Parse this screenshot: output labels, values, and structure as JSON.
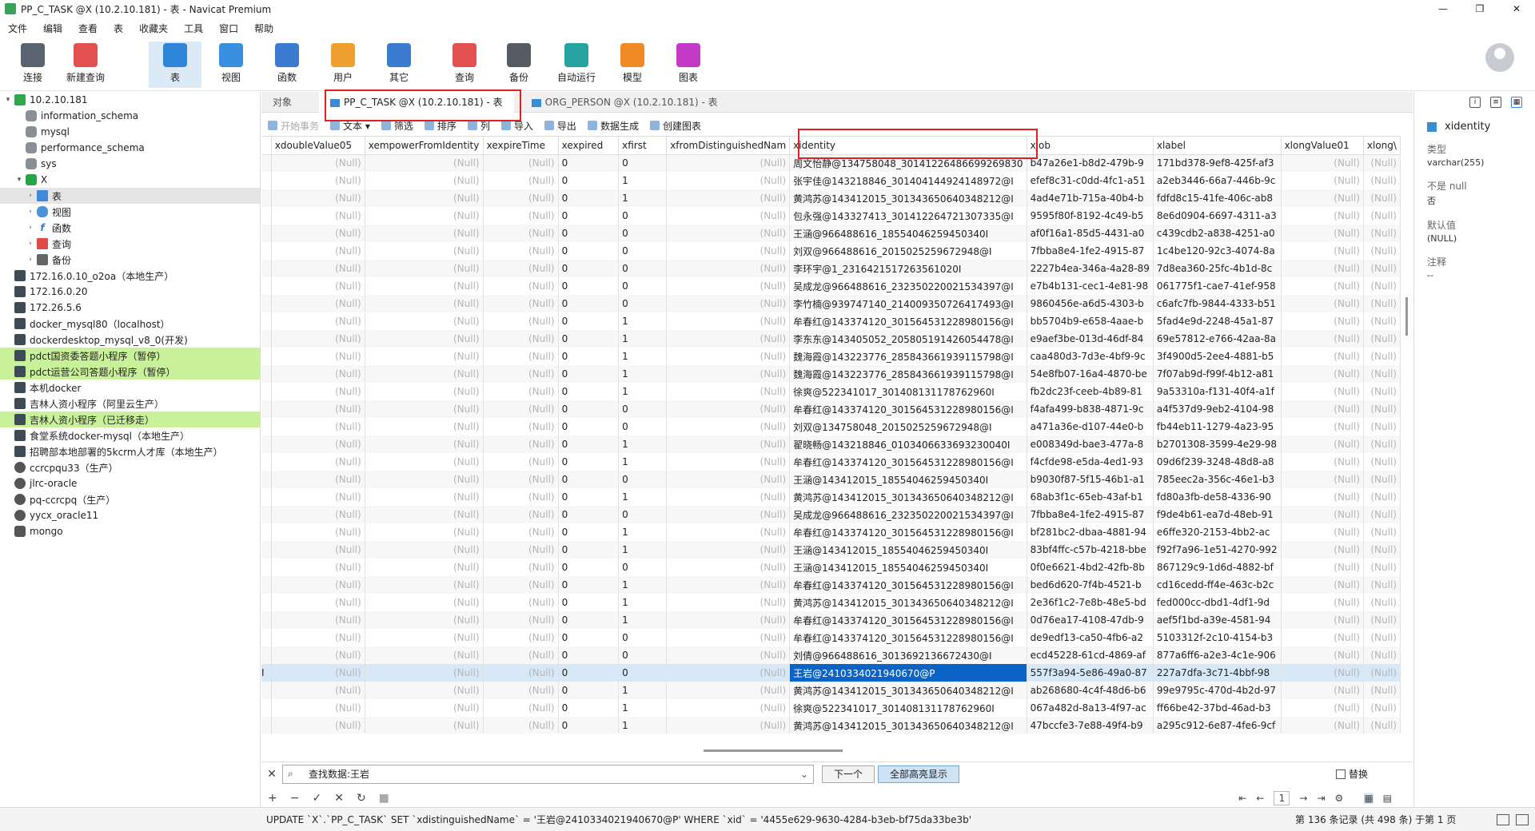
{
  "window": {
    "title": "PP_C_TASK @X (10.2.10.181) - 表 - Navicat Premium",
    "controls": [
      "—",
      "❐",
      "✕"
    ]
  },
  "menu": [
    "文件",
    "编辑",
    "查看",
    "表",
    "收藏夹",
    "工具",
    "窗口",
    "帮助"
  ],
  "toolbar": [
    {
      "label": "连接",
      "icon": "connect-icon",
      "color": "#5a6470"
    },
    {
      "label": "新建查询",
      "icon": "new-query-icon",
      "color": "#e35050"
    },
    {
      "label": "表",
      "icon": "table-icon",
      "color": "#2f86d9"
    },
    {
      "label": "视图",
      "icon": "view-icon",
      "color": "#3a8fe0"
    },
    {
      "label": "函数",
      "icon": "function-icon",
      "color": "#3b7bd0"
    },
    {
      "label": "用户",
      "icon": "user-icon",
      "color": "#f0a030"
    },
    {
      "label": "其它",
      "icon": "tools-icon",
      "color": "#3b7bd0"
    },
    {
      "label": "查询",
      "icon": "query-icon",
      "color": "#e35050"
    },
    {
      "label": "备份",
      "icon": "backup-icon",
      "color": "#555b63"
    },
    {
      "label": "自动运行",
      "icon": "robot-icon",
      "color": "#27a3a0"
    },
    {
      "label": "模型",
      "icon": "model-icon",
      "color": "#f08a24"
    },
    {
      "label": "图表",
      "icon": "chart-icon",
      "color": "#c23ac6"
    }
  ],
  "sidebar": {
    "items": [
      {
        "label": "10.2.10.181",
        "level": 0,
        "icon": "conn-green",
        "caret": "▾"
      },
      {
        "label": "information_schema",
        "level": 1,
        "icon": "db"
      },
      {
        "label": "mysql",
        "level": 1,
        "icon": "db"
      },
      {
        "label": "performance_schema",
        "level": 1,
        "icon": "db"
      },
      {
        "label": "sys",
        "level": 1,
        "icon": "db"
      },
      {
        "label": "X",
        "level": 1,
        "icon": "db-green",
        "caret": "▾"
      },
      {
        "label": "表",
        "level": 2,
        "icon": "tbl",
        "caret": "›",
        "selected": true
      },
      {
        "label": "视图",
        "level": 2,
        "icon": "view",
        "caret": "›"
      },
      {
        "label": "函数",
        "level": 2,
        "icon": "fn",
        "caret": "›"
      },
      {
        "label": "查询",
        "level": 2,
        "icon": "query",
        "caret": "›"
      },
      {
        "label": "备份",
        "level": 2,
        "icon": "backup",
        "caret": "›"
      },
      {
        "label": "172.16.0.10_o2oa（本地生产）",
        "level": 0,
        "icon": "conn-dark"
      },
      {
        "label": "172.16.0.20",
        "level": 0,
        "icon": "conn-dark"
      },
      {
        "label": "172.26.5.6",
        "level": 0,
        "icon": "conn-dark"
      },
      {
        "label": "docker_mysql80（localhost）",
        "level": 0,
        "icon": "conn-dark"
      },
      {
        "label": "dockerdesktop_mysql_v8_0(开发)",
        "level": 0,
        "icon": "conn-dark"
      },
      {
        "label": "pdct国资委答题小程序（暂停）",
        "level": 0,
        "icon": "conn-dark",
        "highlight": true
      },
      {
        "label": "pdct运营公司答题小程序（暂停）",
        "level": 0,
        "icon": "conn-dark",
        "highlight": true
      },
      {
        "label": "本机docker",
        "level": 0,
        "icon": "conn-dark"
      },
      {
        "label": "吉林人资小程序（阿里云生产）",
        "level": 0,
        "icon": "conn-dark"
      },
      {
        "label": "吉林人资小程序（已迁移走）",
        "level": 0,
        "icon": "conn-dark",
        "highlight": true
      },
      {
        "label": "食堂系统docker-mysql（本地生产）",
        "level": 0,
        "icon": "conn-dark"
      },
      {
        "label": "招聘部本地部署的5kcrm人才库（本地生产）",
        "level": 0,
        "icon": "conn-dark"
      },
      {
        "label": "ccrcpqu33（生产）",
        "level": 0,
        "icon": "circle"
      },
      {
        "label": "jlrc-oracle",
        "level": 0,
        "icon": "circle"
      },
      {
        "label": "pq-ccrcpq（生产）",
        "level": 0,
        "icon": "circle"
      },
      {
        "label": "yycx_oracle11",
        "level": 0,
        "icon": "circle"
      },
      {
        "label": "mongo",
        "level": 0,
        "icon": "mongo"
      }
    ]
  },
  "tabs": [
    {
      "label": "对象",
      "active": false
    },
    {
      "label": "PP_C_TASK @X (10.2.10.181) - 表",
      "active": true
    },
    {
      "label": "ORG_PERSON @X (10.2.10.181) - 表",
      "active": false
    }
  ],
  "subtoolbar": [
    {
      "label": "开始事务",
      "disabled": true
    },
    {
      "label": "文本 ▾",
      "disabled": false
    },
    {
      "label": "筛选",
      "disabled": false
    },
    {
      "label": "排序",
      "disabled": false
    },
    {
      "label": "列",
      "disabled": false
    },
    {
      "label": "导入",
      "disabled": false
    },
    {
      "label": "导出",
      "disabled": false
    },
    {
      "label": "数据生成",
      "disabled": false
    },
    {
      "label": "创建图表",
      "disabled": false
    }
  ],
  "grid": {
    "columns": [
      "xdoubleValue05",
      "xempowerFromIdentity",
      "xexpireTime",
      "xexpired",
      "xfirst",
      "xfromDistinguishedNam",
      "xidentity",
      "xjob",
      "xlabel",
      "xlongValue01",
      "xlong\\"
    ],
    "null_text": "(Null)",
    "rows": [
      {
        "xexpired": "0",
        "xfirst": "0",
        "xidentity": "周文怡静@134758048_30141226486699269830",
        "xjob": "b47a26e1-b8d2-479b-9",
        "xlabel": "171bd378-9ef8-425f-af3"
      },
      {
        "xexpired": "0",
        "xfirst": "1",
        "xidentity": "张宇佳@143218846_301404144924148972@I",
        "xjob": "efef8c31-c0dd-4fc1-a51",
        "xlabel": "a2eb3446-66a7-446b-9c"
      },
      {
        "xexpired": "0",
        "xfirst": "1",
        "xidentity": "黄鸿苏@143412015_301343650640348212@I",
        "xjob": "4ad4e71b-715a-40b4-b",
        "xlabel": "fdfd8c15-41fe-406c-ab8"
      },
      {
        "xexpired": "0",
        "xfirst": "0",
        "xidentity": "包永强@143327413_301412264721307335@I",
        "xjob": "9595f80f-8192-4c49-b5",
        "xlabel": "8e6d0904-6697-4311-a3"
      },
      {
        "xexpired": "0",
        "xfirst": "0",
        "xidentity": "王涵@966488616_18554046259450340I",
        "xjob": "af0f16a1-85d5-4431-a0",
        "xlabel": "c439cdb2-a838-4251-a0"
      },
      {
        "xexpired": "0",
        "xfirst": "0",
        "xidentity": "刘双@966488616_2015025259672948@I",
        "xjob": "7fbba8e4-1fe2-4915-87",
        "xlabel": "1c4be120-92c3-4074-8a"
      },
      {
        "xexpired": "0",
        "xfirst": "0",
        "xidentity": "李环宇@1_2316421517263561020I",
        "xjob": "2227b4ea-346a-4a28-89",
        "xlabel": "7d8ea360-25fc-4b1d-8c"
      },
      {
        "xexpired": "0",
        "xfirst": "0",
        "xidentity": "吴成龙@966488616_232350220021534397@I",
        "xjob": "e7b4b131-cec1-4e81-98",
        "xlabel": "061775f1-cae7-41ef-958"
      },
      {
        "xexpired": "0",
        "xfirst": "0",
        "xidentity": "李竹楠@939747140_214009350726417493@I",
        "xjob": "9860456e-a6d5-4303-b",
        "xlabel": "c6afc7fb-9844-4333-b51"
      },
      {
        "xexpired": "0",
        "xfirst": "1",
        "xidentity": "牟春红@143374120_301564531228980156@I",
        "xjob": "bb5704b9-e658-4aae-b",
        "xlabel": "5fad4e9d-2248-45a1-87"
      },
      {
        "xexpired": "0",
        "xfirst": "1",
        "xidentity": "李东东@143405052_205805191426054478@I",
        "xjob": "e9aef3be-013d-46df-84",
        "xlabel": "69e57812-e766-42aa-8a"
      },
      {
        "xexpired": "0",
        "xfirst": "1",
        "xidentity": "魏海霞@143223776_285843661939115798@I",
        "xjob": "caa480d3-7d3e-4bf9-9c",
        "xlabel": "3f4900d5-2ee4-4881-b5"
      },
      {
        "xexpired": "0",
        "xfirst": "1",
        "xidentity": "魏海霞@143223776_285843661939115798@I",
        "xjob": "54e8fb07-16a4-4870-be",
        "xlabel": "7f07ab9d-f99f-4b12-a81"
      },
      {
        "xexpired": "0",
        "xfirst": "1",
        "xidentity": "徐爽@522341017_301408131178762960I",
        "xjob": "fb2dc23f-ceeb-4b89-81",
        "xlabel": "9a53310a-f131-40f4-a1f"
      },
      {
        "xexpired": "0",
        "xfirst": "0",
        "xidentity": "牟春红@143374120_301564531228980156@I",
        "xjob": "f4afa499-b838-4871-9c",
        "xlabel": "a4f537d9-9eb2-4104-98"
      },
      {
        "xexpired": "0",
        "xfirst": "0",
        "xidentity": "刘双@134758048_2015025259672948@I",
        "xjob": "a471a36e-d107-44e0-b",
        "xlabel": "fb44eb11-1279-4a23-95"
      },
      {
        "xexpired": "0",
        "xfirst": "1",
        "xidentity": "翟晓畅@143218846_0103406633693230040I",
        "xjob": "e008349d-bae3-477a-8",
        "xlabel": "b2701308-3599-4e29-98"
      },
      {
        "xexpired": "0",
        "xfirst": "1",
        "xidentity": "牟春红@143374120_301564531228980156@I",
        "xjob": "f4cfde98-e5da-4ed1-93",
        "xlabel": "09d6f239-3248-48d8-a8"
      },
      {
        "xexpired": "0",
        "xfirst": "0",
        "xidentity": "王涵@143412015_18554046259450340I",
        "xjob": "b9030f87-5f15-46b1-a1",
        "xlabel": "785eec2a-356c-46e1-b3"
      },
      {
        "xexpired": "0",
        "xfirst": "1",
        "xidentity": "黄鸿苏@143412015_301343650640348212@I",
        "xjob": "68ab3f1c-65eb-43af-b1",
        "xlabel": "fd80a3fb-de58-4336-90"
      },
      {
        "xexpired": "0",
        "xfirst": "0",
        "xidentity": "吴成龙@966488616_232350220021534397@I",
        "xjob": "7fbba8e4-1fe2-4915-87",
        "xlabel": "f9de4b61-ea7d-48eb-91"
      },
      {
        "xexpired": "0",
        "xfirst": "1",
        "xidentity": "牟春红@143374120_301564531228980156@I",
        "xjob": "bf281bc2-dbaa-4881-94",
        "xlabel": "e6ffe320-2153-4bb2-ac"
      },
      {
        "xexpired": "0",
        "xfirst": "1",
        "xidentity": "王涵@143412015_18554046259450340I",
        "xjob": "83bf4ffc-c57b-4218-bbe",
        "xlabel": "f92f7a96-1e51-4270-992"
      },
      {
        "xexpired": "0",
        "xfirst": "0",
        "xidentity": "王涵@143412015_18554046259450340I",
        "xjob": "0f0e6621-4bd2-42fb-8b",
        "xlabel": "867129c9-1d6d-4882-bf"
      },
      {
        "xexpired": "0",
        "xfirst": "1",
        "xidentity": "牟春红@143374120_301564531228980156@I",
        "xjob": "bed6d620-7f4b-4521-b",
        "xlabel": "cd16cedd-ff4e-463c-b2c"
      },
      {
        "xexpired": "0",
        "xfirst": "1",
        "xidentity": "黄鸿苏@143412015_301343650640348212@I",
        "xjob": "2e36f1c2-7e8b-48e5-bd",
        "xlabel": "fed000cc-dbd1-4df1-9d"
      },
      {
        "xexpired": "0",
        "xfirst": "1",
        "xidentity": "牟春红@143374120_301564531228980156@I",
        "xjob": "0d76ea17-4108-47db-9",
        "xlabel": "aef5f1bd-a39e-4581-94"
      },
      {
        "xexpired": "0",
        "xfirst": "0",
        "xidentity": "牟春红@143374120_301564531228980156@I",
        "xjob": "de9edf13-ca50-4fb6-a2",
        "xlabel": "5103312f-2c10-4154-b3"
      },
      {
        "xexpired": "0",
        "xfirst": "0",
        "xidentity": "刘倩@966488616_3013692136672430@I",
        "xjob": "ecd45228-61cd-4869-af",
        "xlabel": "877a6ff6-a2e3-4c1e-906"
      },
      {
        "xexpired": "0",
        "xfirst": "0",
        "xidentity": "王岩@2410334021940670@P",
        "xjob": "557f3a94-5e86-49a0-87",
        "xlabel": "227a7dfa-3c71-4bbf-98",
        "selected": true
      },
      {
        "xexpired": "0",
        "xfirst": "1",
        "xidentity": "黄鸿苏@143412015_301343650640348212@I",
        "xjob": "ab268680-4c4f-48d6-b6",
        "xlabel": "99e9795c-470d-4b2d-97"
      },
      {
        "xexpired": "0",
        "xfirst": "1",
        "xidentity": "徐爽@522341017_301408131178762960I",
        "xjob": "067a482d-8a13-4f97-ac",
        "xlabel": "ff66be42-37bd-46ad-b3"
      },
      {
        "xexpired": "0",
        "xfirst": "1",
        "xidentity": "黄鸿苏@143412015_301343650640348212@I",
        "xjob": "47bccfe3-7e88-49f4-b9",
        "xlabel": "a295c912-6e87-4fe6-9cf"
      }
    ]
  },
  "right_panel": {
    "field_name": "xidentity",
    "type_label": "类型",
    "type_value": "varchar(255)",
    "notnull_label": "不是 null",
    "notnull_value": "否",
    "default_label": "默认值",
    "default_value": "(NULL)",
    "comment_label": "注释",
    "comment_value": "--"
  },
  "findbar": {
    "value": "查找数据:王岩",
    "next_label": "下一个",
    "highlight_label": "全部高亮显示",
    "replace_label": "替换"
  },
  "navbar": {
    "page": "1"
  },
  "status": {
    "sql": "UPDATE `X`.`PP_C_TASK` SET `xdistinguishedName` = '王岩@2410334021940670@P' WHERE `xid` = '4455e629-9630-4284-b3eb-bf75da33be3b'",
    "info": "第 136 条记录 (共 498 条) 于第 1 页"
  }
}
